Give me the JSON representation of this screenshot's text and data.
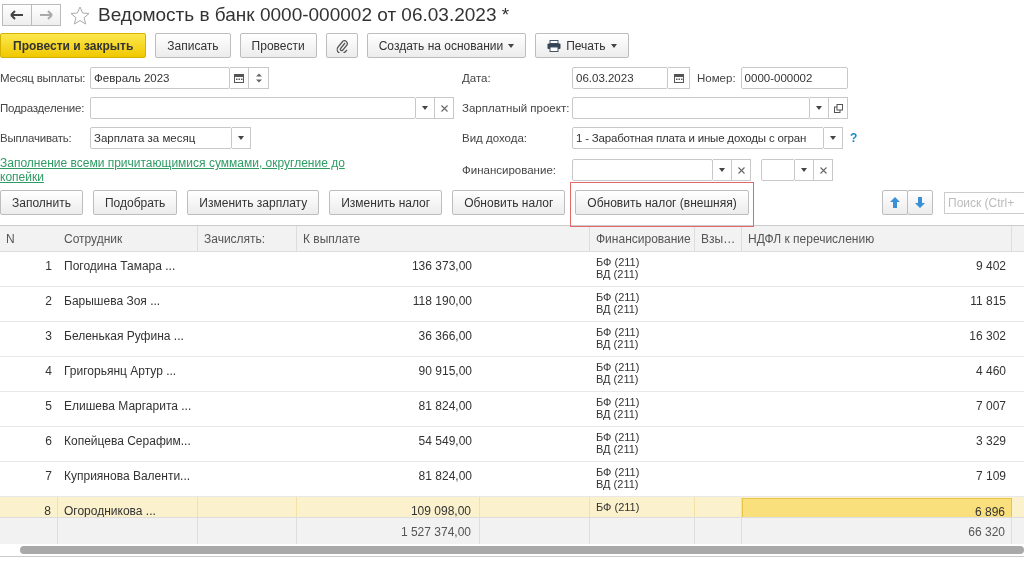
{
  "window": {
    "title": "Ведомость в банк 0000-000002 от 06.03.2023 *"
  },
  "toolbar": [
    {
      "kind": "primary",
      "label": "Провести и закрыть"
    },
    {
      "kind": "button",
      "label": "Записать"
    },
    {
      "kind": "button",
      "label": "Провести"
    },
    {
      "kind": "attach"
    },
    {
      "kind": "menu",
      "label": "Создать на основании"
    },
    {
      "kind": "print",
      "label": "Печать"
    }
  ],
  "form": {
    "left": [
      {
        "label": "Месяц выплаты:",
        "fields": [
          {
            "kind": "month",
            "value": "Февраль 2023"
          }
        ]
      },
      {
        "label": "Подразделение:",
        "fields": [
          {
            "kind": "select-clear"
          }
        ]
      },
      {
        "label": "Выплачивать:",
        "fields": [
          {
            "kind": "select",
            "value": "Зарплата за месяц"
          }
        ]
      }
    ],
    "link": "Заполнение всеми причитающимися суммами, округление до копейки",
    "right": [
      {
        "label": "Дата:",
        "fields": [
          {
            "kind": "date",
            "value": "06.03.2023"
          },
          {
            "kind": "text",
            "label": "Номер:",
            "value": "0000-000002"
          }
        ]
      },
      {
        "label": "Зарплатный проект:",
        "fields": [
          {
            "kind": "select-open"
          }
        ]
      },
      {
        "label": "Вид дохода:",
        "fields": [
          {
            "kind": "select",
            "value": "1 - Заработная плата и иные доходы с огран"
          }
        ],
        "help": "?"
      },
      {
        "label": "Финансирование:",
        "fields": [
          {
            "kind": "select-clear"
          },
          {
            "kind": "select-clear"
          }
        ]
      }
    ]
  },
  "commands": [
    {
      "label": "Заполнить",
      "highlighted": false
    },
    {
      "label": "Подобрать",
      "highlighted": false
    },
    {
      "label": "Изменить зарплату",
      "highlighted": false
    },
    {
      "label": "Изменить налог",
      "highlighted": false
    },
    {
      "label": "Обновить налог",
      "highlighted": false
    },
    {
      "label": "Обновить налог (внешняя)",
      "highlighted": true
    }
  ],
  "search": {
    "placeholder": "Поиск (Ctrl+"
  },
  "table": {
    "columns": [
      "N",
      "Сотрудник",
      "Зачислять:",
      "К выплате",
      "Финансирование",
      "Взы…",
      "НДФЛ к перечислению"
    ],
    "rows": [
      {
        "n": "1",
        "employee": "Погодина Тамара ...",
        "amount": "136 373,00",
        "financing": [
          "БФ (211)",
          "ВД (211)"
        ],
        "ndfl": "9 402",
        "selected": false,
        "ndfl_focused": false
      },
      {
        "n": "2",
        "employee": "Барышева Зоя ...",
        "amount": "118 190,00",
        "financing": [
          "БФ (211)",
          "ВД (211)"
        ],
        "ndfl": "11 815",
        "selected": false,
        "ndfl_focused": false
      },
      {
        "n": "3",
        "employee": "Беленькая Руфина ...",
        "amount": "36 366,00",
        "financing": [
          "БФ (211)",
          "ВД (211)"
        ],
        "ndfl": "16 302",
        "selected": false,
        "ndfl_focused": false
      },
      {
        "n": "4",
        "employee": "Григорьянц Артур ...",
        "amount": "90 915,00",
        "financing": [
          "БФ (211)",
          "ВД (211)"
        ],
        "ndfl": "4 460",
        "selected": false,
        "ndfl_focused": false
      },
      {
        "n": "5",
        "employee": "Елишева Маргарита ...",
        "amount": "81 824,00",
        "financing": [
          "БФ (211)",
          "ВД (211)"
        ],
        "ndfl": "7 007",
        "selected": false,
        "ndfl_focused": false
      },
      {
        "n": "6",
        "employee": "Копейцева Серафим...",
        "amount": "54 549,00",
        "financing": [
          "БФ (211)",
          "ВД (211)"
        ],
        "ndfl": "3 329",
        "selected": false,
        "ndfl_focused": false
      },
      {
        "n": "7",
        "employee": "Куприянова Валенти...",
        "amount": "81 824,00",
        "financing": [
          "БФ (211)",
          "ВД (211)"
        ],
        "ndfl": "7 109",
        "selected": false,
        "ndfl_focused": false
      },
      {
        "n": "8",
        "employee": "Огородникова ...",
        "amount": "109 098,00",
        "financing": [
          "БФ (211)"
        ],
        "ndfl": "6 896",
        "selected": true,
        "ndfl_focused": true
      }
    ],
    "totals": {
      "amount": "1 527 374,00",
      "ndfl": "66 320"
    }
  }
}
